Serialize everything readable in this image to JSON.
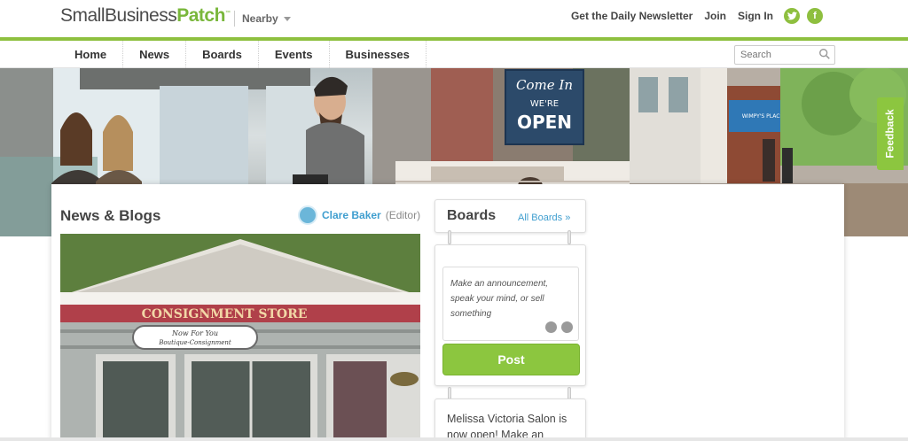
{
  "header": {
    "logo_part1": "SmallBusiness",
    "logo_part2": "Patch",
    "nearby": "Nearby",
    "links": [
      "Get the Daily Newsletter",
      "Join",
      "Sign In"
    ],
    "social": [
      "twitter-icon",
      "facebook-icon"
    ]
  },
  "nav": {
    "items": [
      "Home",
      "News",
      "Boards",
      "Events",
      "Businesses"
    ],
    "search_placeholder": "Search"
  },
  "hero": {
    "signs": {
      "shop_sign_top": "Come In",
      "shop_sign_mid": "WE'RE",
      "shop_sign_bottom": "OPEN",
      "awning": "WIMPY'S PLACE"
    }
  },
  "news": {
    "title": "News & Blogs",
    "editor_name": "Clare Baker",
    "editor_role": "(Editor)",
    "image": {
      "sign": "CONSIGNMENT STORE",
      "plaque_line1": "Now For You",
      "plaque_line2": "Boutique-Consignment"
    }
  },
  "boards": {
    "title": "Boards",
    "all_link": "All Boards »",
    "post_placeholder": "Make an announcement, speak your mind, or sell something",
    "post_button": "Post",
    "story_preview": "Melissa Victoria Salon is now open! Make an"
  },
  "feedback": "Feedback",
  "colors": {
    "brand_green": "#8cc63f",
    "link_blue": "#3f9ecf",
    "text_dark": "#444444"
  }
}
